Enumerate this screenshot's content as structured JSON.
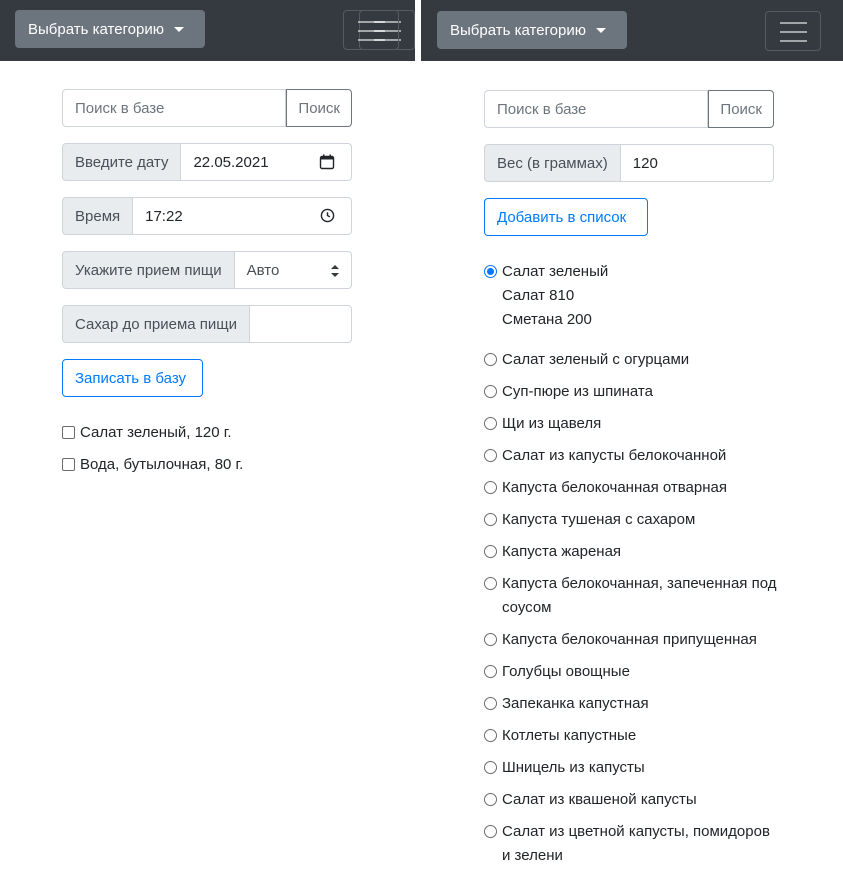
{
  "navbar": {
    "category_button": "Выбрать категорию",
    "toggler_icon": "menu-icon"
  },
  "left": {
    "search": {
      "placeholder": "Поиск в базе",
      "button": "Поиск"
    },
    "date": {
      "label": "Введите дату",
      "value": "22.05.2021",
      "icon": "calendar-icon"
    },
    "time": {
      "label": "Время",
      "value": "17:22",
      "icon": "clock-icon"
    },
    "meal": {
      "label": "Укажите прием пищи",
      "value": "Авто"
    },
    "sugar": {
      "label": "Сахар до приема пищи",
      "value": ""
    },
    "submit": "Записать в базу",
    "items": [
      {
        "label": "Салат зеленый, 120 г.",
        "checked": false
      },
      {
        "label": "Вода, бутылочная, 80 г.",
        "checked": false
      }
    ]
  },
  "right": {
    "search": {
      "placeholder": "Поиск в базе",
      "button": "Поиск"
    },
    "weight": {
      "label": "Вес (в граммах)",
      "value": "120"
    },
    "add_button": "Добавить в список",
    "selected": {
      "title": "Салат зеленый",
      "details": [
        "Салат 810",
        "Сметана 200"
      ]
    },
    "options": [
      "Салат зеленый с огурцами",
      "Суп-пюре из шпината",
      "Щи из щавеля",
      "Салат из капусты белокочанной",
      "Капуста белокочанная отварная",
      "Капуста тушеная с сахаром",
      "Капуста жареная",
      "Капуста белокочанная, запеченная под соусом",
      "Капуста белокочанная припущенная",
      "Голубцы овощные",
      "Запеканка капустная",
      "Котлеты капустные",
      "Шницель из капусты",
      "Салат из квашеной капусты",
      "Салат из цветной капусты, помидоров и зелени"
    ]
  },
  "colors": {
    "navbar": "#343a40",
    "secondary": "#6c757d",
    "primary": "#007bff",
    "addon": "#e9ecef"
  }
}
